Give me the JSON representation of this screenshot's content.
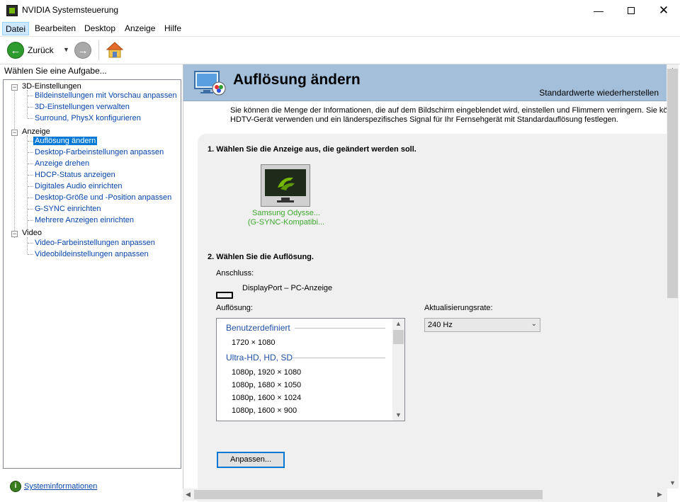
{
  "window": {
    "title": "NVIDIA Systemsteuerung",
    "icon": "nvidia-control-panel-icon",
    "controls": [
      "minimize-icon",
      "maximize-icon",
      "close-icon"
    ]
  },
  "menu": {
    "items": [
      {
        "label": "Datei",
        "active": true
      },
      {
        "label": "Bearbeiten",
        "active": false
      },
      {
        "label": "Desktop",
        "active": false
      },
      {
        "label": "Anzeige",
        "active": false
      },
      {
        "label": "Hilfe",
        "active": false
      }
    ]
  },
  "toolbar": {
    "back_label": "Zurück",
    "back_icon": "back-arrow-icon",
    "forward_icon": "forward-arrow-icon",
    "home_icon": "home-icon",
    "colors": {
      "back": "#2d9b2d",
      "forward": "#a9a9a9"
    }
  },
  "sidebar": {
    "header": "Wählen Sie eine Aufgabe...",
    "categories": [
      {
        "label": "3D-Einstellungen",
        "items": [
          "Bildeinstellungen mit Vorschau anpassen",
          "3D-Einstellungen verwalten",
          "Surround, PhysX konfigurieren"
        ]
      },
      {
        "label": "Anzeige",
        "items": [
          "Auflösung ändern",
          "Desktop-Farbeinstellungen anpassen",
          "Anzeige drehen",
          "HDCP-Status anzeigen",
          "Digitales Audio einrichten",
          "Desktop-Größe und -Position anpassen",
          "G-SYNC einrichten",
          "Mehrere Anzeigen einrichten"
        ]
      },
      {
        "label": "Video",
        "items": [
          "Video-Farbeinstellungen anpassen",
          "Videobildeinstellungen anpassen"
        ]
      }
    ],
    "selected": "Auflösung ändern",
    "system_info": "Systeminformationen"
  },
  "main": {
    "title": "Auflösung ändern",
    "restore_defaults": "Standardwerte wiederherstellen",
    "description_1": "Sie können die Menge der Informationen, die auf dem Bildschirm eingeblendet wird, einstellen und Flimmern verringern. Sie können",
    "description_2": "HDTV-Gerät verwenden und ein länderspezifisches Signal für Ihr Fernsehgerät mit Standardauflösung festlegen.",
    "step1": "1. Wählen Sie die Anzeige aus, die geändert werden soll.",
    "display_name_1": "Samsung Odysse...",
    "display_name_2": "(G-SYNC-Kompatibi...",
    "step2": "2. Wählen Sie die Auflösung.",
    "connection_label": "Anschluss:",
    "connection_value": "DisplayPort – PC-Anzeige",
    "resolution_label": "Auflösung:",
    "refresh_label": "Aktualisierungsrate:",
    "refresh_value": "240 Hz",
    "resolution_groups": [
      {
        "label": "Benutzerdefiniert",
        "items": [
          "1720 × 1080"
        ]
      },
      {
        "label": "Ultra-HD, HD, SD",
        "items": [
          "1080p, 1920 × 1080",
          "1080p, 1680 × 1050",
          "1080p, 1600 × 1024",
          "1080p, 1600 × 900"
        ]
      }
    ],
    "customize_button": "Anpassen..."
  },
  "colors": {
    "header_bg": "#a4bfda",
    "link": "#0645ad",
    "selected": "#0078d7",
    "display_caption": "#3ca82c",
    "group_label": "#1d4fa8"
  }
}
